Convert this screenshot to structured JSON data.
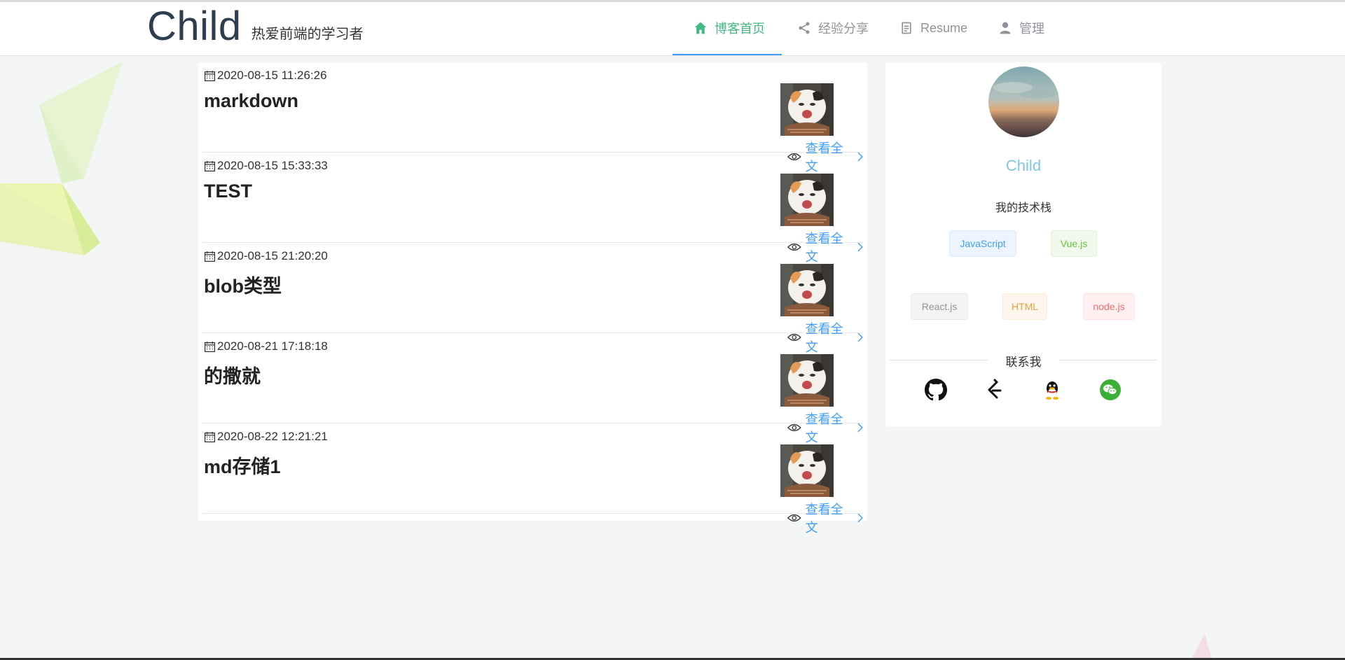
{
  "header": {
    "brand_name": "Child",
    "brand_tagline": "热爱前端的学习者",
    "nav": [
      {
        "label": "博客首页",
        "icon": "home-icon",
        "active": true
      },
      {
        "label": "经验分享",
        "icon": "share-icon",
        "active": false
      },
      {
        "label": "Resume",
        "icon": "document-icon",
        "active": false
      },
      {
        "label": "管理",
        "icon": "user-icon",
        "active": false
      }
    ]
  },
  "posts": [
    {
      "date": "2020-08-15 11:26:26",
      "title": "markdown",
      "read_more": "查看全文"
    },
    {
      "date": "2020-08-15 15:33:33",
      "title": "TEST",
      "read_more": "查看全文"
    },
    {
      "date": "2020-08-15 21:20:20",
      "title": "blob类型",
      "read_more": "查看全文"
    },
    {
      "date": "2020-08-21 17:18:18",
      "title": "的撒就",
      "read_more": "查看全文"
    },
    {
      "date": "2020-08-22 12:21:21",
      "title": "md存储1",
      "read_more": "查看全文"
    }
  ],
  "sidebar": {
    "name": "Child",
    "stack_title": "我的技术栈",
    "tags": [
      "JavaScript",
      "Vue.js",
      "React.js",
      "HTML",
      "node.js"
    ],
    "contact_title": "联系我",
    "social_icons": [
      "github-icon",
      "leetcode-icon",
      "qq-icon",
      "wechat-icon"
    ]
  },
  "colors": {
    "accent_green": "#42b983",
    "accent_blue": "#409eff",
    "name_color": "#7ec8e3"
  }
}
